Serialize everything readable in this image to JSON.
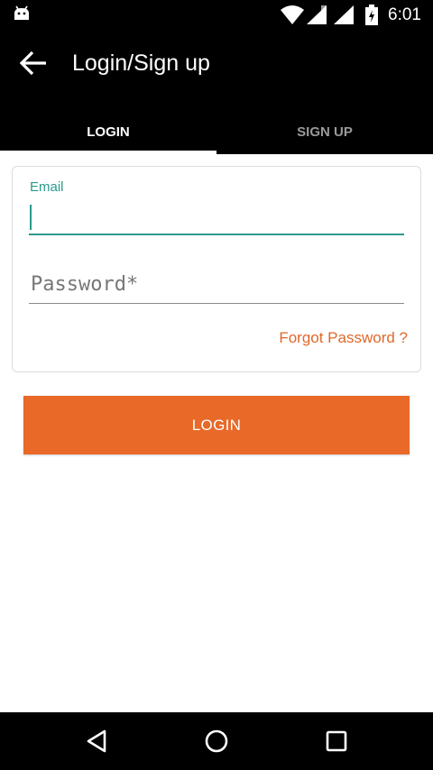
{
  "status_bar": {
    "time": "6:01",
    "icons": [
      "android-debug-icon",
      "wifi-icon",
      "signal-icon",
      "signal-icon",
      "battery-charging-icon"
    ]
  },
  "app_bar": {
    "title": "Login/Sign up",
    "back_icon": "arrow-back-icon"
  },
  "tabs": [
    {
      "label": "LOGIN",
      "selected": true
    },
    {
      "label": "SIGN UP",
      "selected": false
    }
  ],
  "form": {
    "email": {
      "label": "Email",
      "value": "",
      "placeholder": ""
    },
    "password": {
      "value": "",
      "placeholder": "Password*"
    },
    "forgot_label": "Forgot Password ?"
  },
  "login_button_label": "LOGIN",
  "nav_bar": {
    "icons": [
      "nav-back-icon",
      "nav-home-icon",
      "nav-recents-icon"
    ]
  },
  "colors": {
    "accent_teal": "#2a9a8c",
    "brand_orange": "#e86928",
    "bar_background": "#000000"
  }
}
